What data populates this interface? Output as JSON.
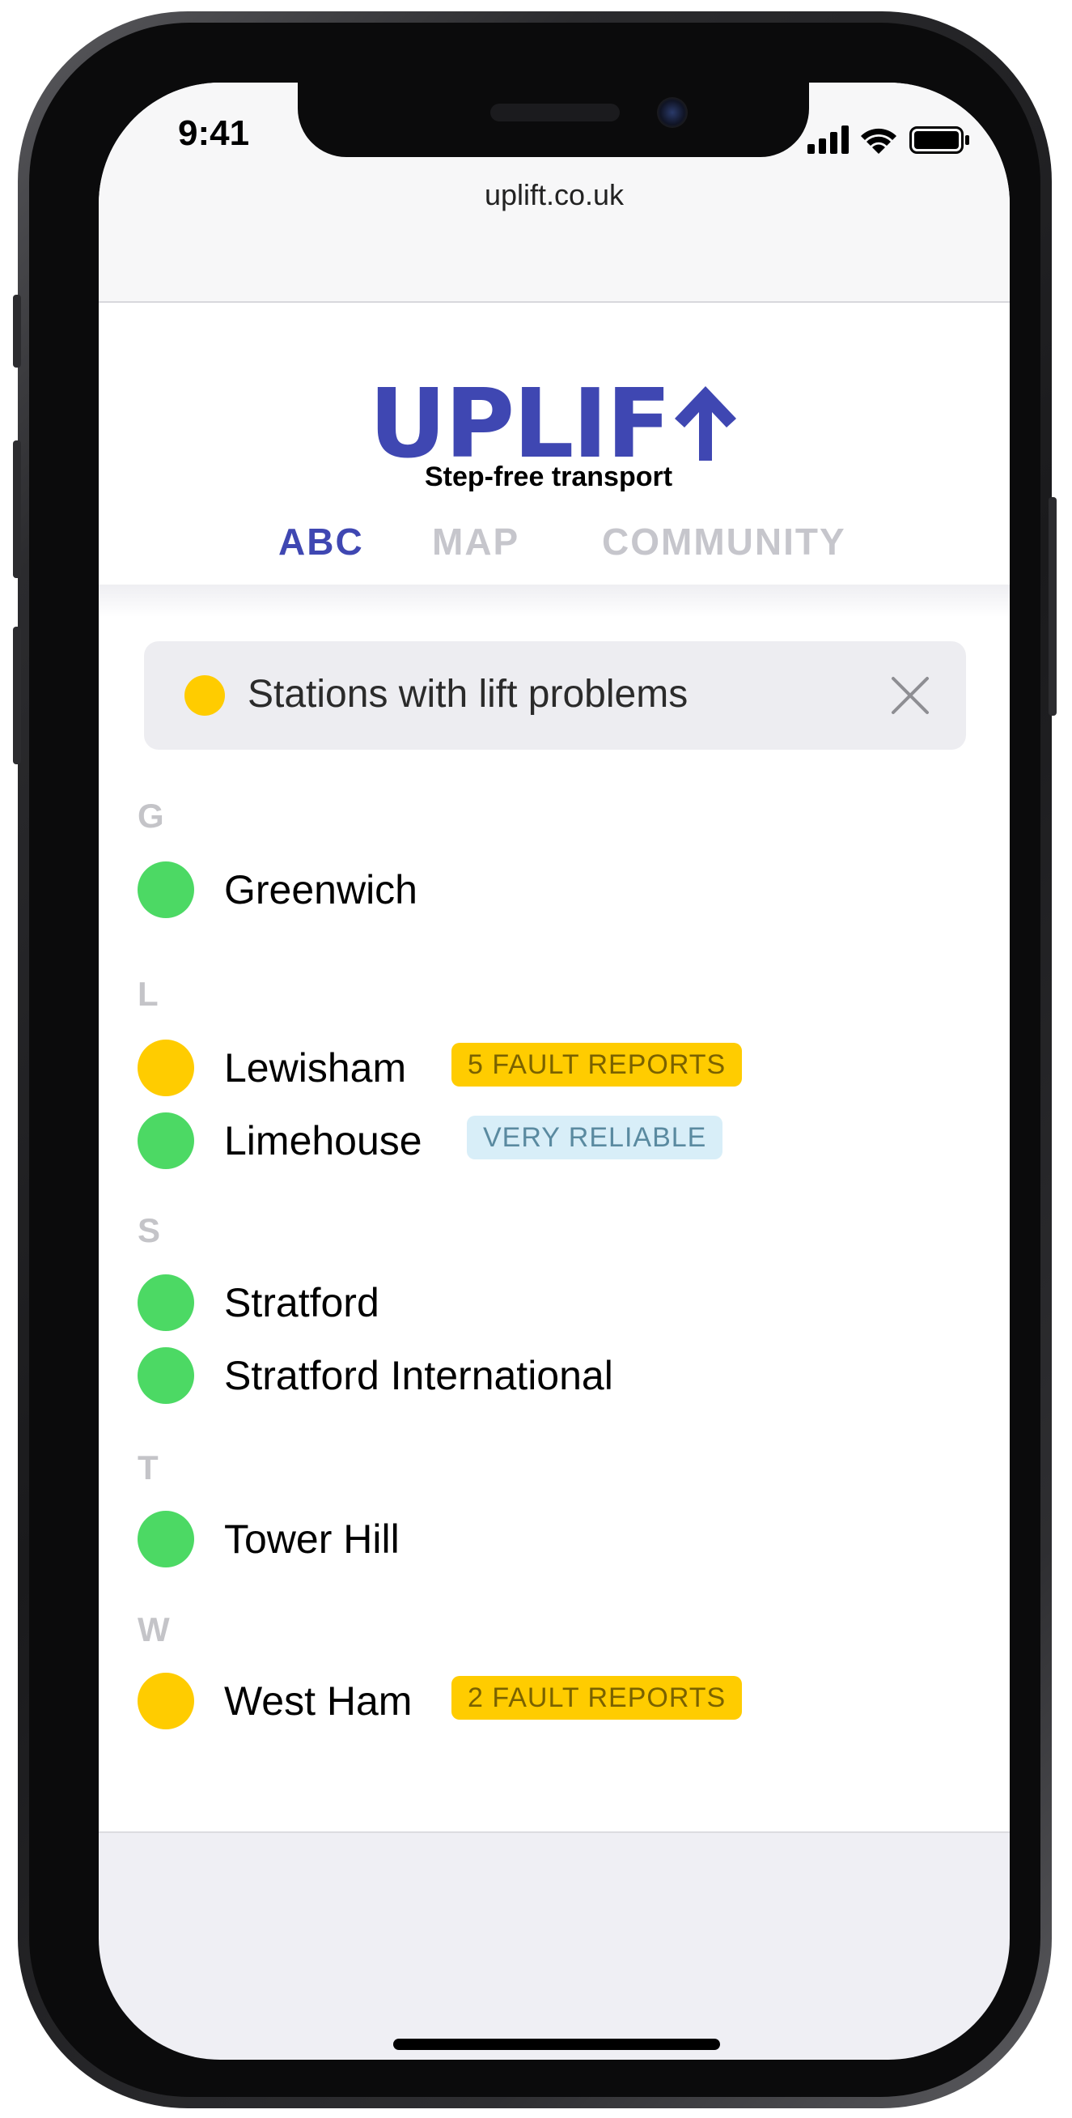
{
  "status_bar": {
    "time": "9:41"
  },
  "browser": {
    "url": "uplift.co.uk"
  },
  "logo": {
    "text": "UPLIF",
    "tagline": "Step-free transport"
  },
  "tabs": [
    {
      "label": "ABC",
      "active": true
    },
    {
      "label": "MAP",
      "active": false
    },
    {
      "label": "COMMUNITY",
      "active": false
    }
  ],
  "filter": {
    "label": "Stations with lift problems",
    "dot_color": "#ffcc00"
  },
  "sections": [
    {
      "letter": "G",
      "stations": [
        {
          "name": "Greenwich",
          "status": "green",
          "badge": ""
        }
      ]
    },
    {
      "letter": "L",
      "stations": [
        {
          "name": "Lewisham",
          "status": "yellow",
          "badge": "5 FAULT REPORTS"
        },
        {
          "name": "Limehouse",
          "status": "green",
          "badge": "VERY RELIABLE"
        }
      ]
    },
    {
      "letter": "S",
      "stations": [
        {
          "name": "Stratford",
          "status": "green",
          "badge": ""
        },
        {
          "name": "Stratford International",
          "status": "green",
          "badge": ""
        }
      ]
    },
    {
      "letter": "T",
      "stations": [
        {
          "name": "Tower Hill",
          "status": "green",
          "badge": ""
        }
      ]
    },
    {
      "letter": "W",
      "stations": [
        {
          "name": "West Ham",
          "status": "yellow",
          "badge": "2 FAULT REPORTS"
        }
      ]
    }
  ],
  "colors": {
    "brand": "#3f47b2",
    "status_green": "#4cd964",
    "status_yellow": "#ffcc00",
    "badge_reliable_bg": "#d8eef8"
  },
  "icons": {
    "signal": "cellular-signal-icon",
    "wifi": "wifi-icon",
    "battery": "battery-icon",
    "arrow": "up-arrow-icon",
    "close": "close-icon"
  }
}
